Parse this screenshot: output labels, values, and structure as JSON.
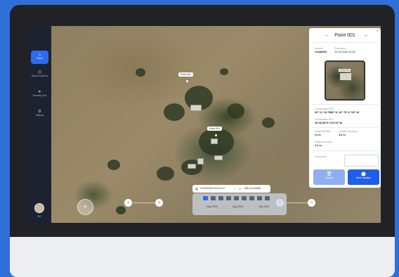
{
  "sidebar": {
    "items": [
      {
        "label": "Home",
        "icon": "home-icon",
        "glyph": "⌂"
      },
      {
        "label": "Saved Locations",
        "icon": "pin-icon",
        "glyph": "◎"
      },
      {
        "label": "Recently Sent",
        "icon": "send-icon",
        "glyph": "➤"
      },
      {
        "label": "Settings",
        "icon": "gear-icon",
        "glyph": "⚙"
      }
    ],
    "user_initials": "RJ"
  },
  "map": {
    "labels": [
      "Point 001",
      "Point 002"
    ]
  },
  "controls": {
    "prev": "‹",
    "next": "›",
    "zoom_in": "+",
    "zoom_out": "−",
    "locate": "+",
    "corner": "⌂"
  },
  "date_bar": {
    "date_time": "21/09/2024  05:43:12",
    "flight": "AB #1234568"
  },
  "timeline": {
    "labels": [
      "May 2020",
      "Aug 2024",
      "July 2024"
    ],
    "left_arrow": "←",
    "right_arrow": "→"
  },
  "panel": {
    "title": "Point 001",
    "prev": "←",
    "next": "→",
    "close": "×",
    "number_label": "Number",
    "number_value": "#1138469",
    "processed_label": "Processed",
    "processed_value": "12.03.2025  13:45",
    "photo_tag": "Point 001",
    "utm_label": "Coordinates UTM",
    "utm_value": "33° 11' 16.7588\" N, 34° 78' 9.715\" W",
    "geo_label": "Coordinates GEO",
    "geo_value": "40°43'48\"N 74°0'22\"W",
    "height_label": "Height EGM96",
    "height_value": "21 m",
    "loc_acc_label": "Location accuracy",
    "loc_acc_value": "4.3 m",
    "height_acc_label": "Height accuracy",
    "height_acc_value": "2.2 m",
    "comments_label": "Comments",
    "delete_label": "Delete",
    "save_label": "Save location"
  }
}
